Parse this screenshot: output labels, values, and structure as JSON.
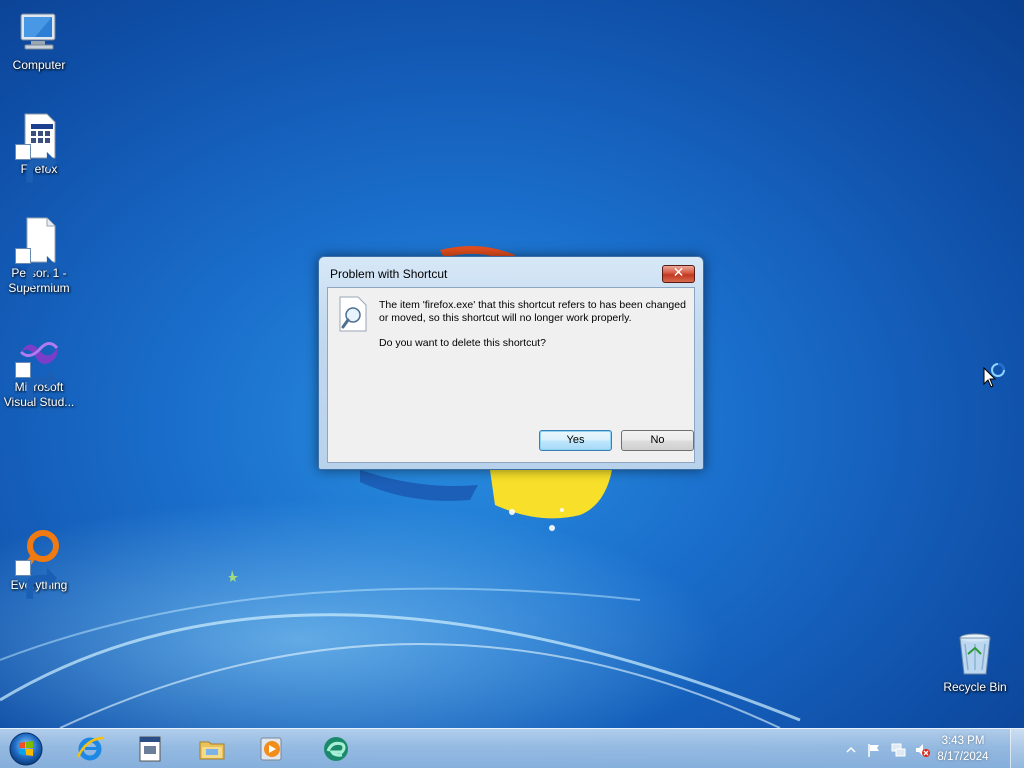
{
  "desktop": {
    "icons": [
      {
        "label": "Computer",
        "icon": "computer-icon"
      },
      {
        "label": "Firefox",
        "icon": "firefox-shortcut-icon"
      },
      {
        "label": "Person 1 - Supermium",
        "icon": "document-shortcut-icon"
      },
      {
        "label": "Microsoft Visual Stud...",
        "icon": "visual-studio-icon"
      },
      {
        "label": "Everything",
        "icon": "everything-search-icon"
      },
      {
        "label": "Recycle Bin",
        "icon": "recycle-bin-icon"
      }
    ]
  },
  "dialog": {
    "title": "Problem with Shortcut",
    "close_label": "✕",
    "message": "The item 'firefox.exe' that this shortcut refers to has been changed or moved, so this shortcut will no longer work properly.",
    "question": "Do you want to delete this shortcut?",
    "yes_label": "Yes",
    "no_label": "No"
  },
  "taskbar": {
    "pinned": [
      "internet-explorer-icon",
      "app-window-icon",
      "file-explorer-icon",
      "media-player-icon",
      "edge-like-browser-icon"
    ],
    "tray_icons": [
      "show-hidden-icons-chevron",
      "action-center-flag-icon",
      "network-icon",
      "volume-muted-icon"
    ],
    "time": "3:43 PM",
    "date": "8/17/2024"
  },
  "colors": {
    "wallpaper": "#1a6fcc",
    "dialog_frame": "#c2d9ef",
    "default_button": "#bee6fd"
  }
}
